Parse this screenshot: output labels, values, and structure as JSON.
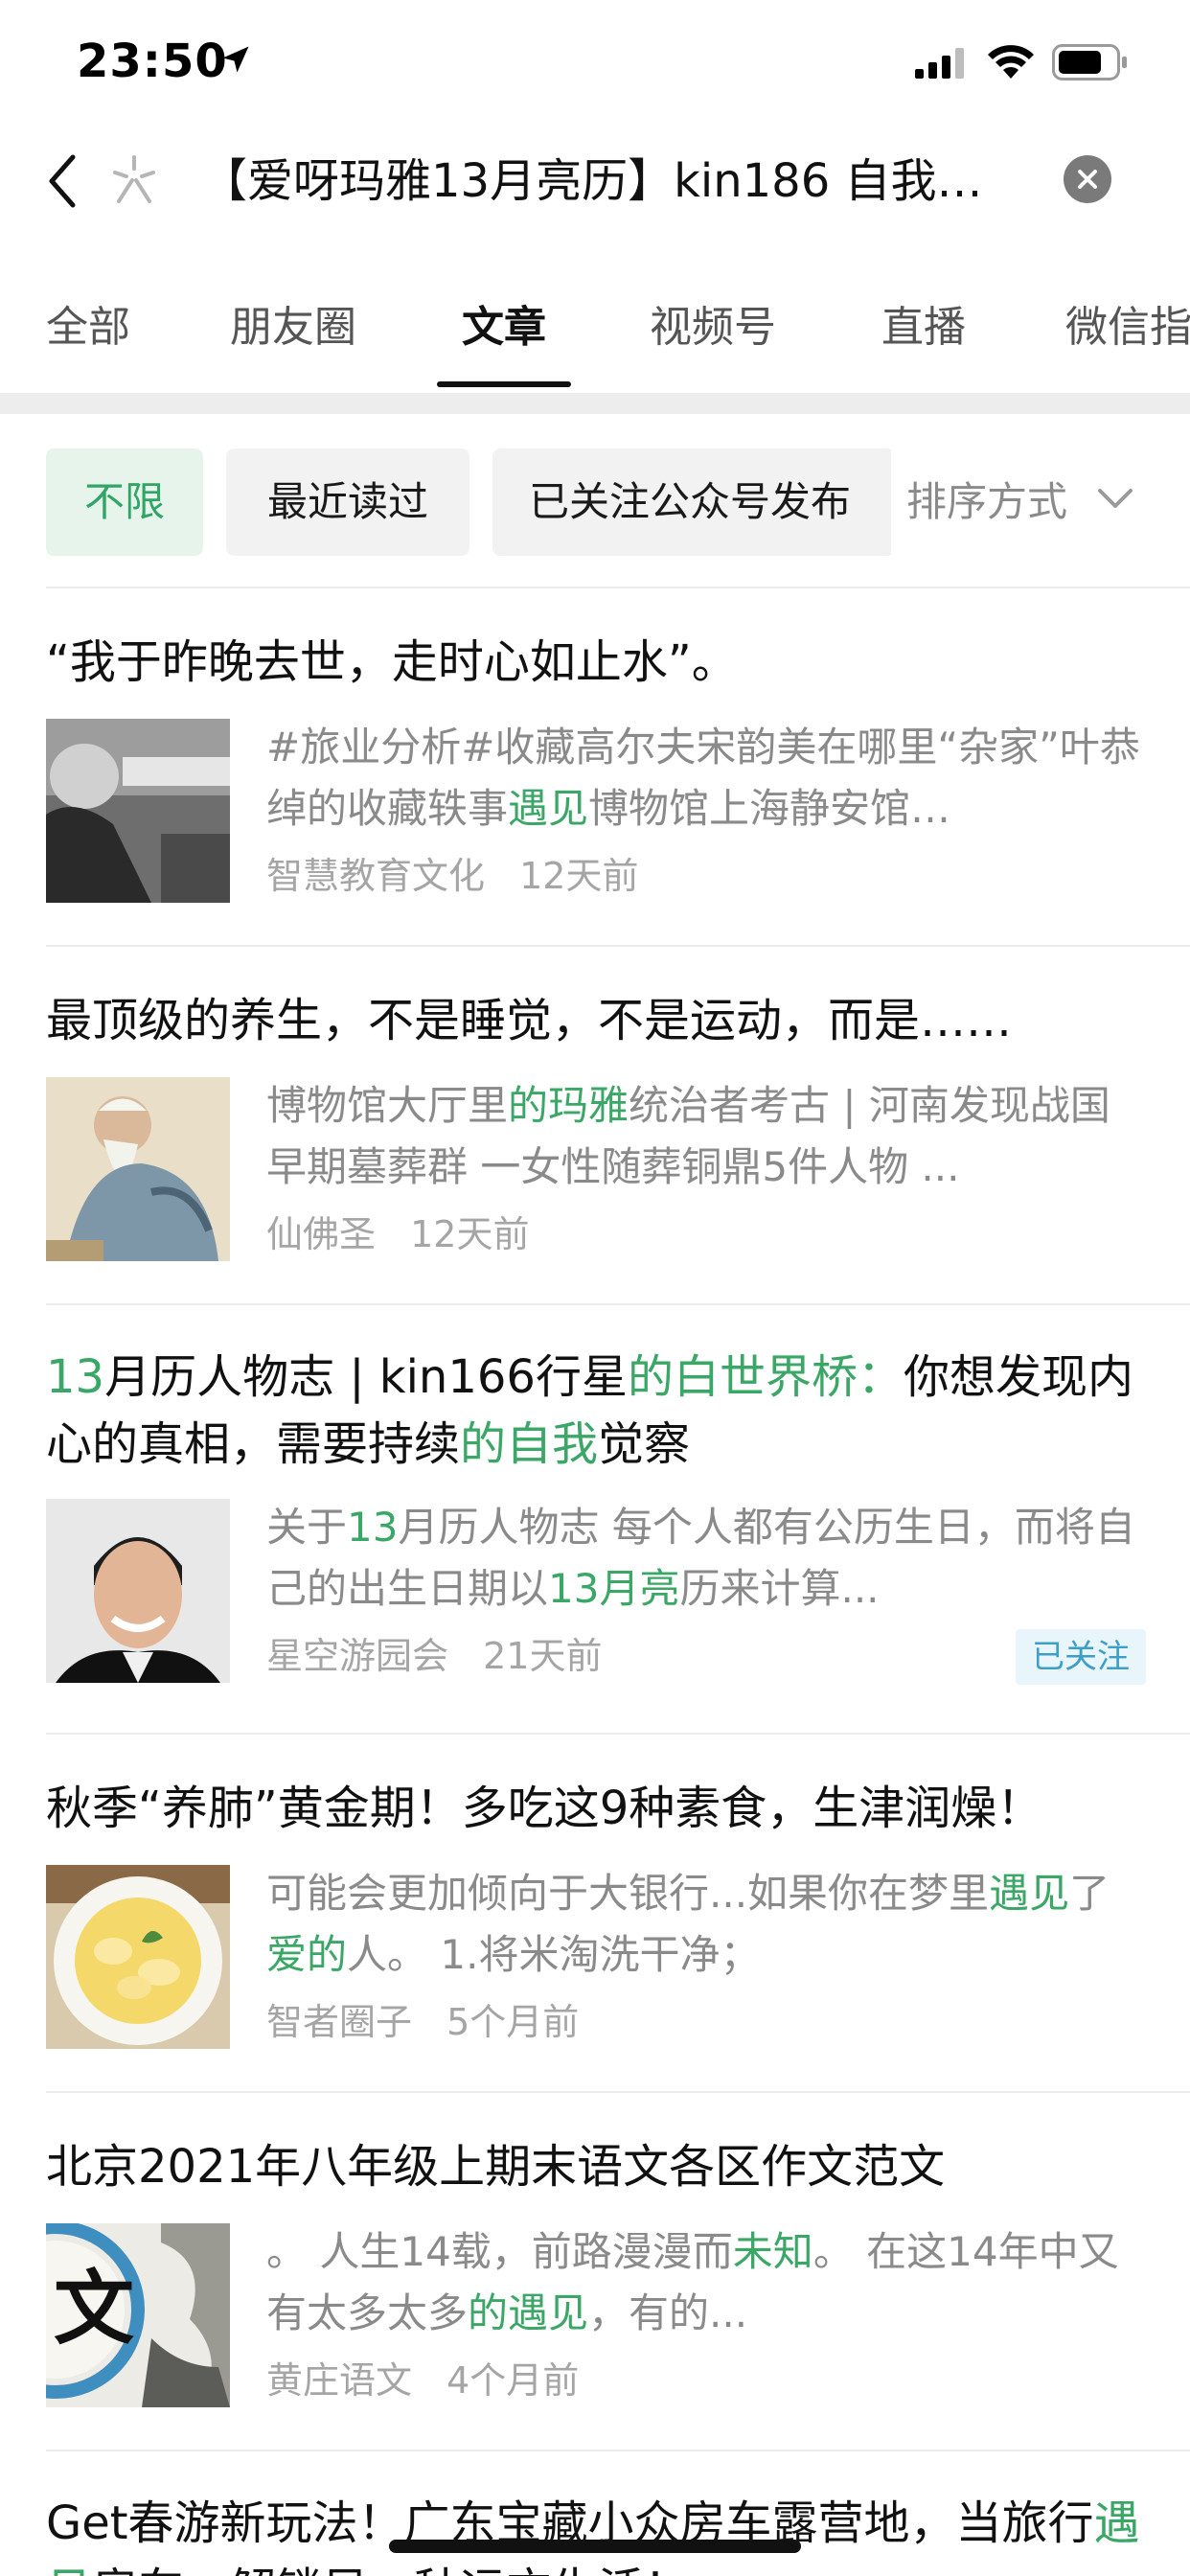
{
  "status_bar": {
    "time": "23:50"
  },
  "search": {
    "query": "【爱呀玛雅13月亮历】kin186 自我…"
  },
  "tabs": [
    {
      "label": "全部"
    },
    {
      "label": "朋友圈"
    },
    {
      "label": "文章"
    },
    {
      "label": "视频号"
    },
    {
      "label": "直播"
    },
    {
      "label": "微信指"
    }
  ],
  "active_tab": "文章",
  "filters": {
    "chips": [
      {
        "label": "不限"
      },
      {
        "label": "最近读过"
      },
      {
        "label": "已关注公众号发布"
      }
    ],
    "sort_label": "排序方式"
  },
  "colors": {
    "accent": "#3ba766",
    "followed_badge": "#3d9ec7"
  },
  "results": [
    {
      "title_parts": [
        {
          "text": "“我于昨晚去世，走时心如止水”。",
          "hl": false
        }
      ],
      "snippet_parts": [
        {
          "text": "#旅业分析#收藏高尔夫宋韵美在哪里“杂家”叶恭绰的收藏轶事",
          "hl": false
        },
        {
          "text": "遇见",
          "hl": true
        },
        {
          "text": "博物馆上海静安馆…",
          "hl": false
        }
      ],
      "source": "智慧教育文化",
      "time": "12天前",
      "thumbnail": "grayscale-elderly-photo"
    },
    {
      "title_parts": [
        {
          "text": "最顶级的养生，不是睡觉，不是运动，而是……",
          "hl": false
        }
      ],
      "snippet_parts": [
        {
          "text": "博物馆大厅里",
          "hl": false
        },
        {
          "text": "的玛雅",
          "hl": true
        },
        {
          "text": "统治者考古 | 河南发现战国早期墓葬群 一女性随葬铜鼎5件人物 ...",
          "hl": false
        }
      ],
      "source": "仙佛圣",
      "time": "12天前",
      "thumbnail": "sage-painting"
    },
    {
      "title_parts": [
        {
          "text": "13",
          "hl": true
        },
        {
          "text": "月历人物志 | kin166行星",
          "hl": false
        },
        {
          "text": "的白世界桥：",
          "hl": true
        },
        {
          "text": "你想发现内心的真相，需要持续",
          "hl": false
        },
        {
          "text": "的自我",
          "hl": true
        },
        {
          "text": "觉察",
          "hl": false
        }
      ],
      "snippet_parts": [
        {
          "text": "关于",
          "hl": false
        },
        {
          "text": "13",
          "hl": true
        },
        {
          "text": "月历人物志 每个人都有公历生日，而将自己的出生日期以",
          "hl": false
        },
        {
          "text": "13月亮",
          "hl": true
        },
        {
          "text": "历来计算...",
          "hl": false
        }
      ],
      "source": "星空游园会",
      "time": "21天前",
      "badge": "已关注",
      "thumbnail": "man-portrait"
    },
    {
      "title_parts": [
        {
          "text": "秋季“养肺”黄金期！多吃这9种素食，生津润燥！",
          "hl": false
        }
      ],
      "snippet_parts": [
        {
          "text": "可能会更加倾向于大银行...如果你在梦里",
          "hl": false
        },
        {
          "text": "遇见",
          "hl": true
        },
        {
          "text": "了",
          "hl": false
        },
        {
          "text": "爱的",
          "hl": true
        },
        {
          "text": "人。 1.将米淘洗干净；",
          "hl": false
        }
      ],
      "source": "智者圈子",
      "time": "5个月前",
      "thumbnail": "pear-soup-bowl"
    },
    {
      "title_parts": [
        {
          "text": "北京2021年八年级上期末语文各区作文范文",
          "hl": false
        }
      ],
      "snippet_parts": [
        {
          "text": "。 人生14载，前路漫漫而",
          "hl": false
        },
        {
          "text": "未知",
          "hl": true
        },
        {
          "text": "。 在这14年中又有太多太多",
          "hl": false
        },
        {
          "text": "的遇见",
          "hl": true
        },
        {
          "text": "，有的...",
          "hl": false
        }
      ],
      "source": "黄庄语文",
      "time": "4个月前",
      "thumbnail": "chinese-wen-character",
      "thumbnail_text": "文"
    },
    {
      "title_parts": [
        {
          "text": "Get春游新玩法！广东宝藏小众房车露营地，当旅行",
          "hl": false
        },
        {
          "text": "遇见",
          "hl": true
        },
        {
          "text": "房车，解锁另一种远方生活！",
          "hl": false
        }
      ]
    }
  ]
}
